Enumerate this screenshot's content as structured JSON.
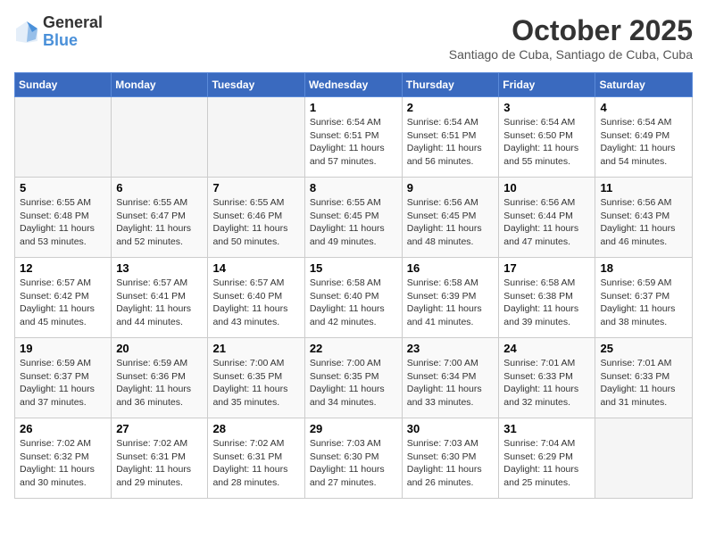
{
  "header": {
    "logo_general": "General",
    "logo_blue": "Blue",
    "month": "October 2025",
    "location": "Santiago de Cuba, Santiago de Cuba, Cuba"
  },
  "weekdays": [
    "Sunday",
    "Monday",
    "Tuesday",
    "Wednesday",
    "Thursday",
    "Friday",
    "Saturday"
  ],
  "weeks": [
    [
      {
        "day": "",
        "info": ""
      },
      {
        "day": "",
        "info": ""
      },
      {
        "day": "",
        "info": ""
      },
      {
        "day": "1",
        "info": "Sunrise: 6:54 AM\nSunset: 6:51 PM\nDaylight: 11 hours\nand 57 minutes."
      },
      {
        "day": "2",
        "info": "Sunrise: 6:54 AM\nSunset: 6:51 PM\nDaylight: 11 hours\nand 56 minutes."
      },
      {
        "day": "3",
        "info": "Sunrise: 6:54 AM\nSunset: 6:50 PM\nDaylight: 11 hours\nand 55 minutes."
      },
      {
        "day": "4",
        "info": "Sunrise: 6:54 AM\nSunset: 6:49 PM\nDaylight: 11 hours\nand 54 minutes."
      }
    ],
    [
      {
        "day": "5",
        "info": "Sunrise: 6:55 AM\nSunset: 6:48 PM\nDaylight: 11 hours\nand 53 minutes."
      },
      {
        "day": "6",
        "info": "Sunrise: 6:55 AM\nSunset: 6:47 PM\nDaylight: 11 hours\nand 52 minutes."
      },
      {
        "day": "7",
        "info": "Sunrise: 6:55 AM\nSunset: 6:46 PM\nDaylight: 11 hours\nand 50 minutes."
      },
      {
        "day": "8",
        "info": "Sunrise: 6:55 AM\nSunset: 6:45 PM\nDaylight: 11 hours\nand 49 minutes."
      },
      {
        "day": "9",
        "info": "Sunrise: 6:56 AM\nSunset: 6:45 PM\nDaylight: 11 hours\nand 48 minutes."
      },
      {
        "day": "10",
        "info": "Sunrise: 6:56 AM\nSunset: 6:44 PM\nDaylight: 11 hours\nand 47 minutes."
      },
      {
        "day": "11",
        "info": "Sunrise: 6:56 AM\nSunset: 6:43 PM\nDaylight: 11 hours\nand 46 minutes."
      }
    ],
    [
      {
        "day": "12",
        "info": "Sunrise: 6:57 AM\nSunset: 6:42 PM\nDaylight: 11 hours\nand 45 minutes."
      },
      {
        "day": "13",
        "info": "Sunrise: 6:57 AM\nSunset: 6:41 PM\nDaylight: 11 hours\nand 44 minutes."
      },
      {
        "day": "14",
        "info": "Sunrise: 6:57 AM\nSunset: 6:40 PM\nDaylight: 11 hours\nand 43 minutes."
      },
      {
        "day": "15",
        "info": "Sunrise: 6:58 AM\nSunset: 6:40 PM\nDaylight: 11 hours\nand 42 minutes."
      },
      {
        "day": "16",
        "info": "Sunrise: 6:58 AM\nSunset: 6:39 PM\nDaylight: 11 hours\nand 41 minutes."
      },
      {
        "day": "17",
        "info": "Sunrise: 6:58 AM\nSunset: 6:38 PM\nDaylight: 11 hours\nand 39 minutes."
      },
      {
        "day": "18",
        "info": "Sunrise: 6:59 AM\nSunset: 6:37 PM\nDaylight: 11 hours\nand 38 minutes."
      }
    ],
    [
      {
        "day": "19",
        "info": "Sunrise: 6:59 AM\nSunset: 6:37 PM\nDaylight: 11 hours\nand 37 minutes."
      },
      {
        "day": "20",
        "info": "Sunrise: 6:59 AM\nSunset: 6:36 PM\nDaylight: 11 hours\nand 36 minutes."
      },
      {
        "day": "21",
        "info": "Sunrise: 7:00 AM\nSunset: 6:35 PM\nDaylight: 11 hours\nand 35 minutes."
      },
      {
        "day": "22",
        "info": "Sunrise: 7:00 AM\nSunset: 6:35 PM\nDaylight: 11 hours\nand 34 minutes."
      },
      {
        "day": "23",
        "info": "Sunrise: 7:00 AM\nSunset: 6:34 PM\nDaylight: 11 hours\nand 33 minutes."
      },
      {
        "day": "24",
        "info": "Sunrise: 7:01 AM\nSunset: 6:33 PM\nDaylight: 11 hours\nand 32 minutes."
      },
      {
        "day": "25",
        "info": "Sunrise: 7:01 AM\nSunset: 6:33 PM\nDaylight: 11 hours\nand 31 minutes."
      }
    ],
    [
      {
        "day": "26",
        "info": "Sunrise: 7:02 AM\nSunset: 6:32 PM\nDaylight: 11 hours\nand 30 minutes."
      },
      {
        "day": "27",
        "info": "Sunrise: 7:02 AM\nSunset: 6:31 PM\nDaylight: 11 hours\nand 29 minutes."
      },
      {
        "day": "28",
        "info": "Sunrise: 7:02 AM\nSunset: 6:31 PM\nDaylight: 11 hours\nand 28 minutes."
      },
      {
        "day": "29",
        "info": "Sunrise: 7:03 AM\nSunset: 6:30 PM\nDaylight: 11 hours\nand 27 minutes."
      },
      {
        "day": "30",
        "info": "Sunrise: 7:03 AM\nSunset: 6:30 PM\nDaylight: 11 hours\nand 26 minutes."
      },
      {
        "day": "31",
        "info": "Sunrise: 7:04 AM\nSunset: 6:29 PM\nDaylight: 11 hours\nand 25 minutes."
      },
      {
        "day": "",
        "info": ""
      }
    ]
  ]
}
